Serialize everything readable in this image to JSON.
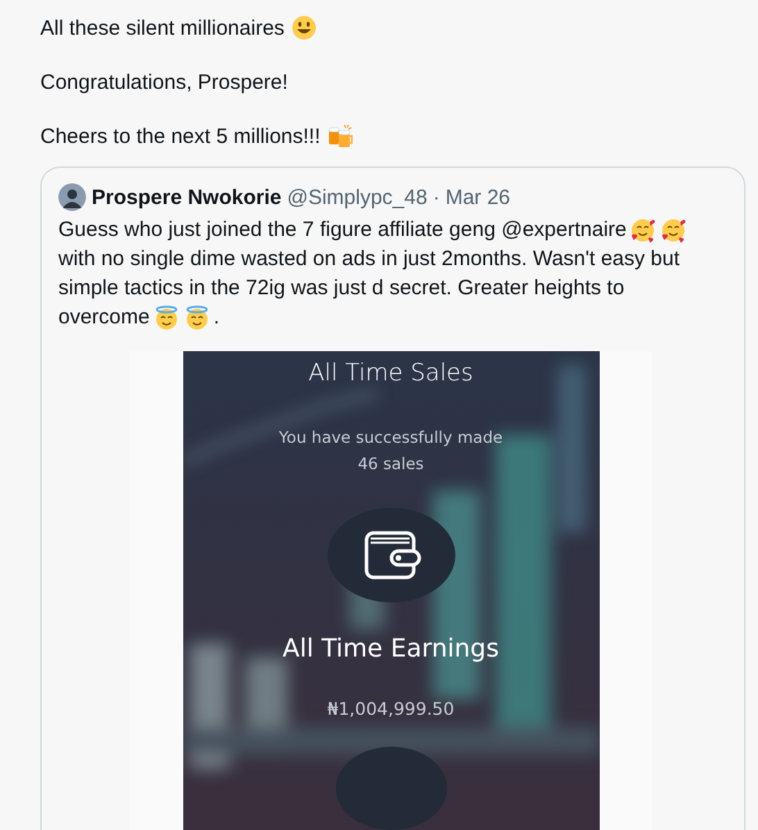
{
  "tweet": {
    "lines": [
      {
        "parts": [
          {
            "kind": "text",
            "text": "All these silent millionaires"
          },
          {
            "kind": "smiley"
          }
        ]
      },
      {
        "parts": [
          {
            "kind": "text",
            "text": "Congratulations, Prospere!"
          }
        ]
      },
      {
        "parts": [
          {
            "kind": "text",
            "text": "Cheers to the next 5 millions!!!"
          },
          {
            "kind": "beers"
          }
        ]
      }
    ]
  },
  "quote": {
    "author": {
      "name": "Prospere Nwokorie",
      "handle": "@Simplypc_48",
      "separator": "·",
      "date": "Mar 26"
    },
    "body": [
      {
        "parts": [
          {
            "kind": "text",
            "text": "Guess who just joined the 7 figure affiliate geng @expertnaire"
          },
          {
            "kind": "hearts"
          },
          {
            "kind": "hearts"
          }
        ]
      },
      {
        "parts": [
          {
            "kind": "text",
            "text": "with no single dime wasted on ads in just 2months. Wasn't easy but simple tactics in the 72ig was just d secret. Greater heights to"
          }
        ]
      },
      {
        "parts": [
          {
            "kind": "text",
            "text": "overcome"
          },
          {
            "kind": "halo"
          },
          {
            "kind": "halo"
          },
          {
            "kind": "text",
            "text": "."
          }
        ]
      }
    ],
    "media": {
      "sales_title": "All Time Sales",
      "sales_text": "You have successfully made",
      "sales_count": "46 sales",
      "earnings_title": "All Time Earnings",
      "earnings_amount": "₦1,004,999.50"
    }
  }
}
